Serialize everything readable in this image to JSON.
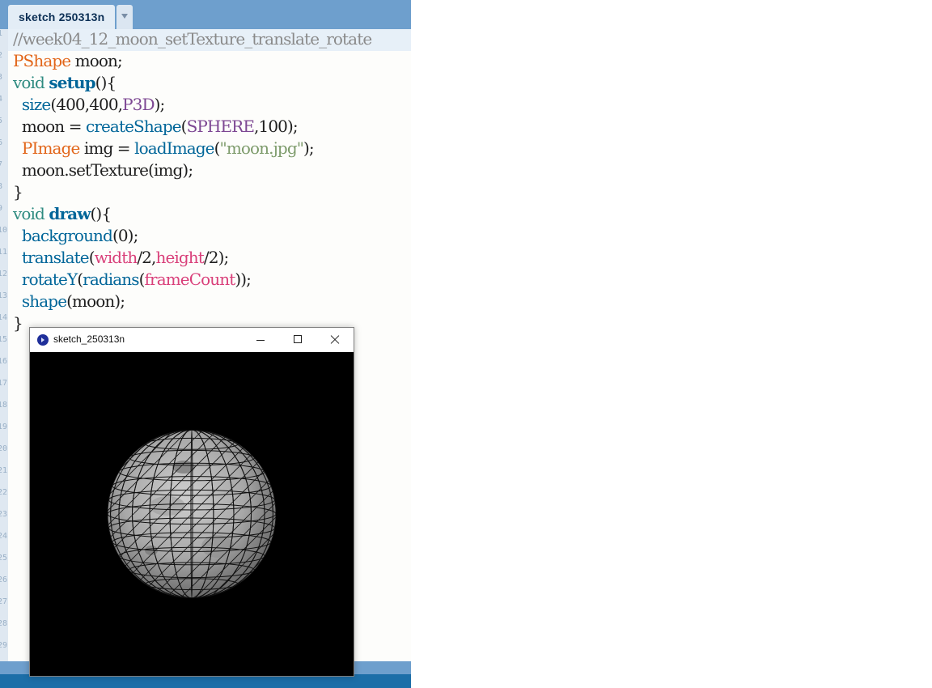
{
  "editor": {
    "tab_label": "sketch 250313n",
    "line_numbers": [
      "1",
      "2",
      "3",
      "4",
      "5",
      "6",
      "7",
      "8",
      "9",
      "10",
      "11",
      "12",
      "13",
      "14",
      "15",
      "16",
      "17",
      "18",
      "19",
      "20",
      "21",
      "22",
      "23",
      "24",
      "25",
      "26",
      "27",
      "28",
      "29"
    ],
    "code": {
      "l1": "//week04_12_moon_setTexture_translate_rotate",
      "l2_type": "PShape",
      "l2_rest": " moon;",
      "l3_kw": "void",
      "l3_fn": "setup",
      "l3_rest": "(){",
      "l4_fn": "size",
      "l4_a": "(400,400,",
      "l4_const": "P3D",
      "l4_b": ");",
      "l5_a": "moon = ",
      "l5_fn": "createShape",
      "l5_b": "(",
      "l5_const": "SPHERE",
      "l5_c": ",100);",
      "l6_type": "PImage",
      "l6_a": " img = ",
      "l6_fn": "loadImage",
      "l6_b": "(",
      "l6_str": "\"moon.jpg\"",
      "l6_c": ");",
      "l7": "moon.setTexture(img);",
      "l8": "}",
      "l9_kw": "void",
      "l9_fn": "draw",
      "l9_rest": "(){",
      "l10_fn": "background",
      "l10_rest": "(0);",
      "l11_fn": "translate",
      "l11_a": "(",
      "l11_v1": "width",
      "l11_b": "/2,",
      "l11_v2": "height",
      "l11_c": "/2);",
      "l12_fn": "rotateY",
      "l12_a": "(",
      "l12_fn2": "radians",
      "l12_b": "(",
      "l12_v": "frameCount",
      "l12_c": "));",
      "l13_fn": "shape",
      "l13_rest": "(moon);",
      "l14": "}"
    }
  },
  "sketch_window": {
    "title": "sketch_250313n",
    "app_icon": "processing-app-icon",
    "controls": [
      "minimize-icon",
      "maximize-icon",
      "close-icon"
    ]
  },
  "colors": {
    "keyword": "#2e8b80",
    "type": "#e2661a",
    "function": "#006699",
    "constant": "#7d4793",
    "builtin_variable": "#d9407a",
    "string": "#7d9b6b",
    "comment": "#8a8a8a",
    "ide_blue": "#6e9fcd"
  }
}
